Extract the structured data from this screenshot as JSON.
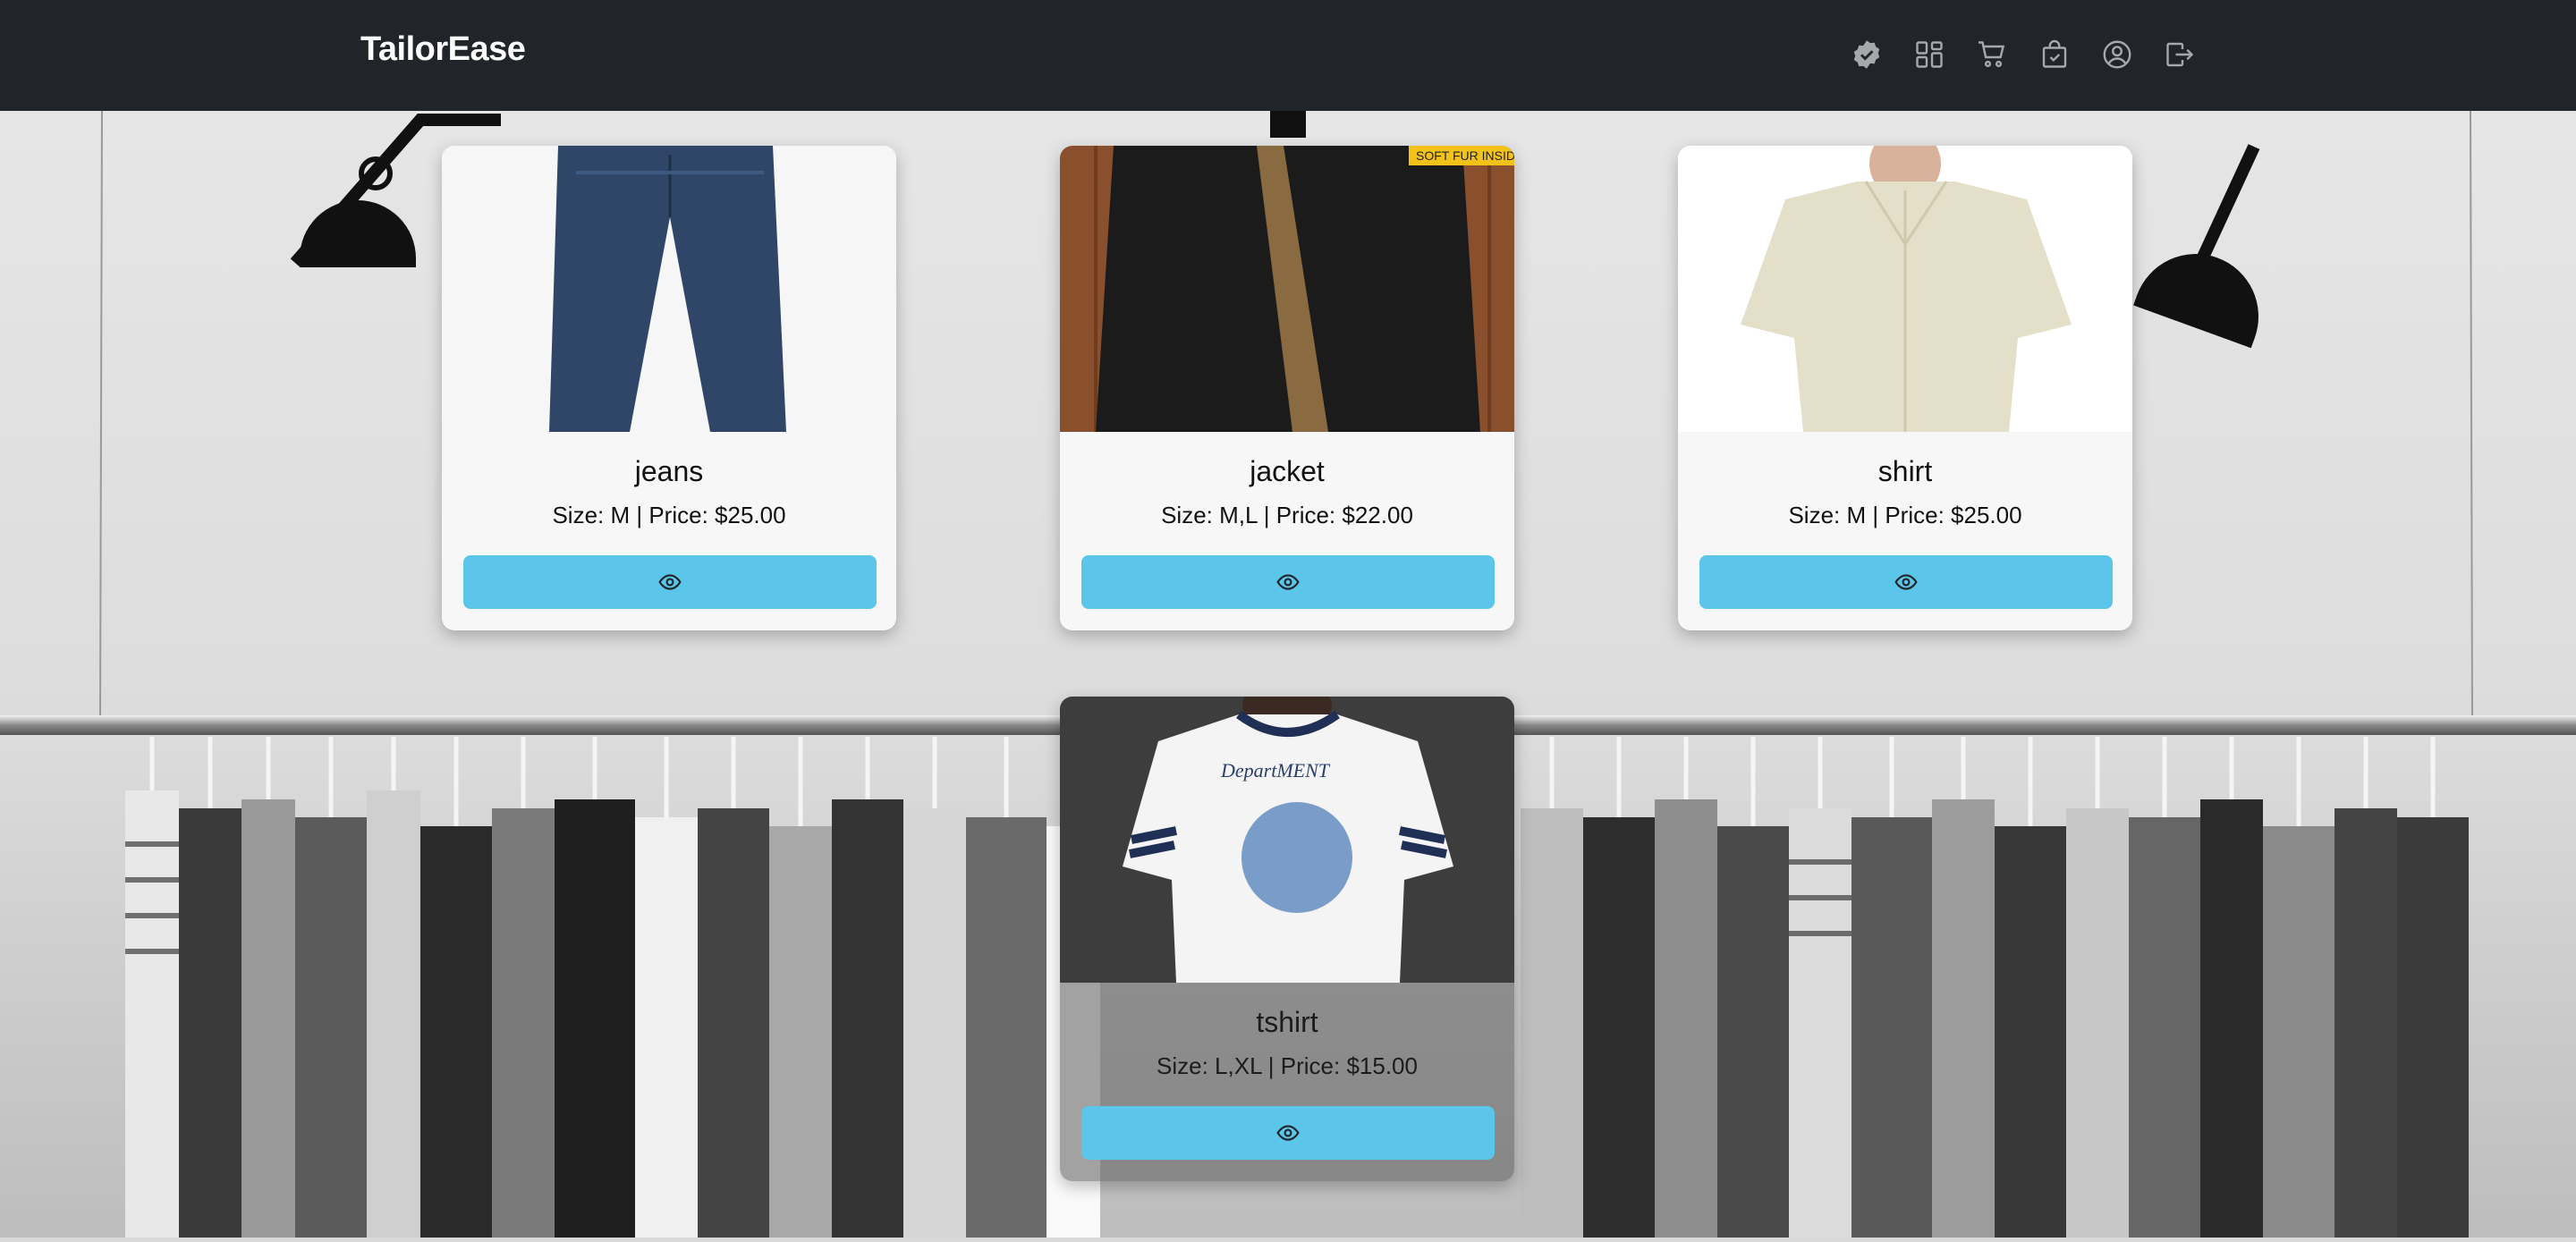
{
  "app": {
    "brand": "TailorEase"
  },
  "nav": {
    "icons": [
      "badge-check-icon",
      "grid-icon",
      "cart-icon",
      "bag-check-icon",
      "user-circle-icon",
      "logout-icon"
    ]
  },
  "colors": {
    "navbar": "#212529",
    "button": "#5bc6ea",
    "nav_icon": "#a6a8ab"
  },
  "products": [
    {
      "name": "jeans",
      "meta": "Size: M | Price: $25.00",
      "button_icon": "eye-icon"
    },
    {
      "name": "jacket",
      "meta": "Size: M,L | Price: $22.00",
      "button_icon": "eye-icon",
      "image_badge": "SOFT FUR INSID"
    },
    {
      "name": "shirt",
      "meta": "Size: M | Price: $25.00",
      "button_icon": "eye-icon"
    },
    {
      "name": "tshirt",
      "meta": "Size: L,XL | Price: $15.00",
      "button_icon": "eye-icon",
      "image_text": "DepartMENT"
    }
  ]
}
